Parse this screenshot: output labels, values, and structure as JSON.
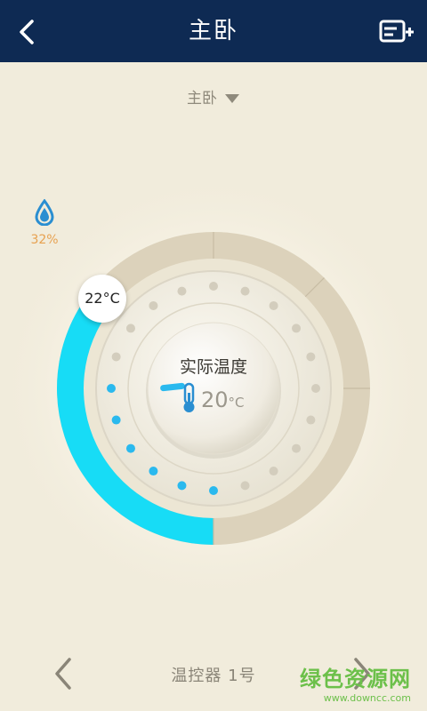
{
  "header": {
    "title": "主卧",
    "back_icon": "chevron-left-icon",
    "add_icon": "add-device-icon"
  },
  "room_selector": {
    "label": "主卧",
    "icon": "caret-down-icon"
  },
  "humidity": {
    "icon": "water-drop-icon",
    "value": "32%"
  },
  "thermostat": {
    "set_temperature": "22°C",
    "actual_label": "实际温度",
    "actual_value": "20",
    "actual_unit": "°C",
    "thermometer_icon": "thermometer-icon",
    "active_color": "#17dcf6",
    "dot_active_color": "#2ab9ee"
  },
  "bottom": {
    "device_name": "温控器 1号",
    "prev_icon": "chevron-left-icon",
    "next_icon": "chevron-right-icon"
  },
  "watermark": {
    "text": "绿色资源网",
    "url": "www.downcc.com"
  }
}
